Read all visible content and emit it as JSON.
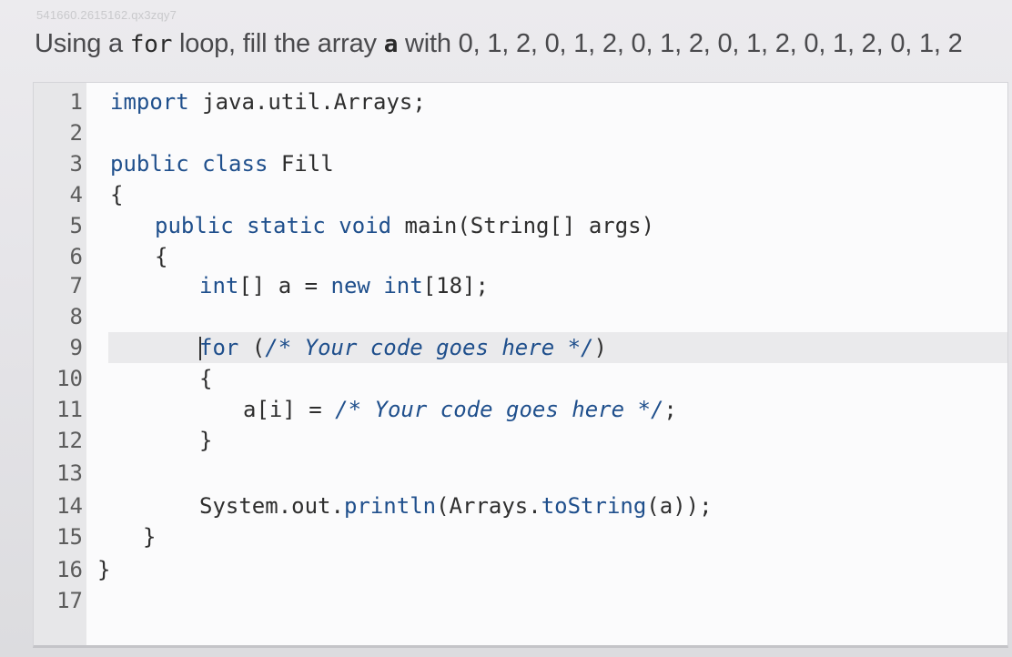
{
  "watermark": "541660.2615162.qx3zqy7",
  "question": {
    "prefix": "Using a ",
    "keyword": "for",
    "middle": " loop, fill the array ",
    "variable": "a",
    "suffix": " with 0, 1, 2, 0, 1, 2, 0, 1, 2, 0, 1, 2, 0, 1, 2, 0, 1, 2"
  },
  "editor": {
    "lines": [
      {
        "num": "1",
        "parts": [
          {
            "cls": "k",
            "text": "import"
          },
          {
            "cls": "p",
            "text": " java.util.Arrays;"
          }
        ]
      },
      {
        "num": "2",
        "parts": []
      },
      {
        "num": "3",
        "parts": [
          {
            "cls": "k",
            "text": "public class"
          },
          {
            "cls": "p",
            "text": " Fill"
          }
        ]
      },
      {
        "num": "4",
        "parts": [
          {
            "cls": "p",
            "text": "{"
          }
        ]
      },
      {
        "num": "5",
        "parts": [
          {
            "cls": "k",
            "text": "public static void"
          },
          {
            "cls": "p",
            "text": " main(String[] args)"
          }
        ]
      },
      {
        "num": "6",
        "parts": [
          {
            "cls": "p",
            "text": "{"
          }
        ]
      },
      {
        "num": "7",
        "parts": [
          {
            "cls": "t",
            "text": "int"
          },
          {
            "cls": "p",
            "text": "[] a = "
          },
          {
            "cls": "k",
            "text": "new int"
          },
          {
            "cls": "p",
            "text": "[18];"
          }
        ]
      },
      {
        "num": "8",
        "parts": []
      },
      {
        "num": "9",
        "parts": [
          {
            "cls": "k",
            "text": "for"
          },
          {
            "cls": "p",
            "text": " ("
          },
          {
            "cls": "c",
            "text": "/* Your code goes here */"
          },
          {
            "cls": "p",
            "text": ")"
          }
        ]
      },
      {
        "num": "10",
        "parts": [
          {
            "cls": "p",
            "text": "{"
          }
        ]
      },
      {
        "num": "11",
        "parts": [
          {
            "cls": "p",
            "text": "a[i] = "
          },
          {
            "cls": "c",
            "text": "/* Your code goes here */"
          },
          {
            "cls": "p",
            "text": ";"
          }
        ]
      },
      {
        "num": "12",
        "parts": [
          {
            "cls": "p",
            "text": "}"
          }
        ]
      },
      {
        "num": "13",
        "parts": []
      },
      {
        "num": "14",
        "parts": [
          {
            "cls": "p",
            "text": "System.out."
          },
          {
            "cls": "k",
            "text": "println"
          },
          {
            "cls": "p",
            "text": "(Arrays."
          },
          {
            "cls": "k",
            "text": "toString"
          },
          {
            "cls": "p",
            "text": "(a));"
          }
        ]
      },
      {
        "num": "15",
        "parts": [
          {
            "cls": "p",
            "text": "}"
          }
        ]
      },
      {
        "num": "16",
        "parts": [
          {
            "cls": "p",
            "text": "}"
          }
        ]
      },
      {
        "num": "17",
        "parts": []
      }
    ]
  }
}
